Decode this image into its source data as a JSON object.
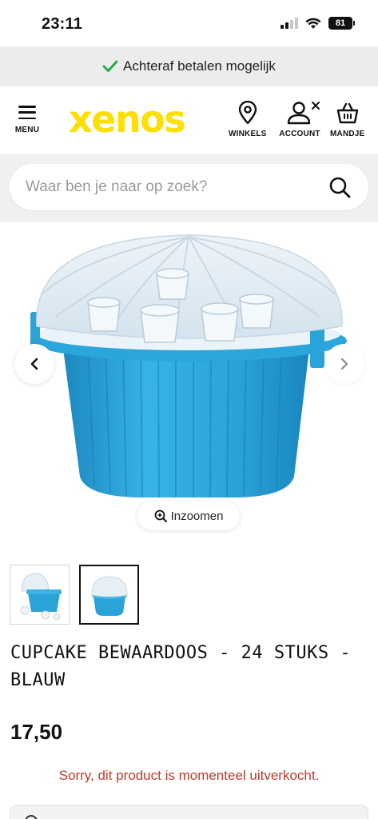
{
  "status_bar": {
    "time": "23:11",
    "battery": "81"
  },
  "promo": {
    "text": "Achteraf betalen mogelijk"
  },
  "header": {
    "menu_label": "MENU",
    "logo": "xenos",
    "stores_label": "WINKELS",
    "account_label": "ACCOUNT",
    "cart_label": "MANDJE"
  },
  "search": {
    "placeholder": "Waar ben je naar op zoek?"
  },
  "gallery": {
    "zoom_label": "Inzoomen"
  },
  "product": {
    "title": "CUPCAKE BEWAARDOOS - 24 STUKS - BLAUW",
    "price": "17,50",
    "stock_message": "Sorry, dit product is momenteel uitverkocht."
  },
  "colors": {
    "brand_yellow": "#ffdf00",
    "product_blue": "#2aa3d8",
    "error_red": "#c0392b",
    "check_green": "#1aa84a"
  }
}
